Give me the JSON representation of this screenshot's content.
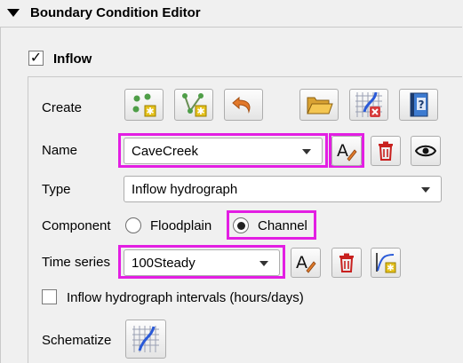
{
  "header": {
    "title": "Boundary Condition Editor"
  },
  "group": {
    "checked": true,
    "check_mark": "✓",
    "title": "Inflow"
  },
  "create_row": {
    "label": "Create",
    "buttons": [
      {
        "icon": "add-points-icon"
      },
      {
        "icon": "add-line-icon"
      },
      {
        "icon": "undo-icon"
      },
      {
        "icon": "open-folder-icon"
      },
      {
        "icon": "delete-schematized-icon"
      },
      {
        "icon": "help-book-icon"
      }
    ]
  },
  "name_row": {
    "label": "Name",
    "value": "CaveCreek"
  },
  "type_row": {
    "label": "Type",
    "value": "Inflow hydrograph"
  },
  "component_row": {
    "label": "Component",
    "options": [
      {
        "label": "Floodplain",
        "selected": false
      },
      {
        "label": "Channel",
        "selected": true
      }
    ]
  },
  "time_series_row": {
    "label": "Time series",
    "value": "100Steady"
  },
  "intervals": {
    "label": "Inflow hydrograph intervals (hours/days)",
    "checked": false
  },
  "schematize_row": {
    "label": "Schematize"
  },
  "colors": {
    "highlight": "#e31ee3",
    "delete_red": "#c8201e"
  }
}
